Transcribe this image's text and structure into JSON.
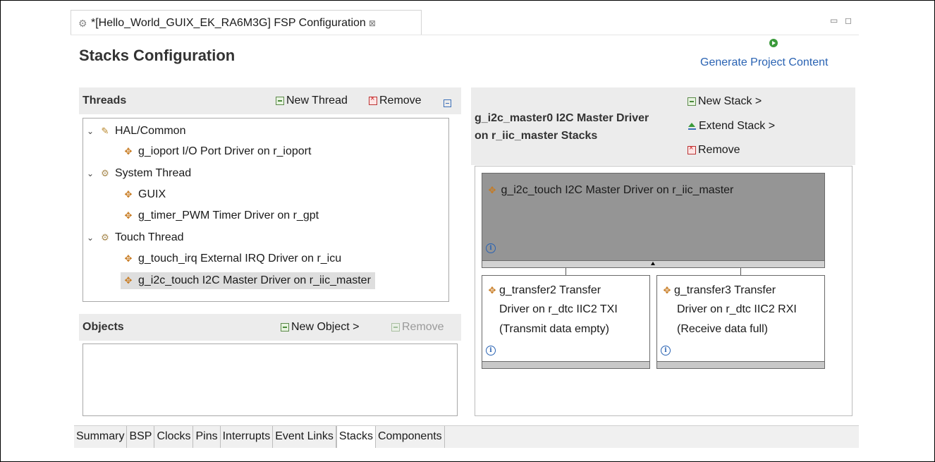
{
  "editor": {
    "tab_title": "*[Hello_World_GUIX_EK_RA6M3G] FSP Configuration",
    "close_glyph": "⊠",
    "minimize_glyph": "▭",
    "maximize_glyph": "◻"
  },
  "page": {
    "title": "Stacks Configuration",
    "generate_label": "Generate Project Content"
  },
  "threads": {
    "title": "Threads",
    "new_thread": "New Thread",
    "remove": "Remove",
    "tree": [
      {
        "label": "HAL/Common",
        "level": 0,
        "icon": "hal-icon",
        "expanded": true
      },
      {
        "label": "g_ioport I/O Port Driver on r_ioport",
        "level": 1,
        "icon": "module-icon"
      },
      {
        "label": "System Thread",
        "level": 0,
        "icon": "thread-gear-icon",
        "expanded": true
      },
      {
        "label": "GUIX",
        "level": 1,
        "icon": "module-icon"
      },
      {
        "label": "g_timer_PWM Timer Driver on r_gpt",
        "level": 1,
        "icon": "module-icon"
      },
      {
        "label": "Touch Thread",
        "level": 0,
        "icon": "thread-gear-icon",
        "expanded": true
      },
      {
        "label": "g_touch_irq External IRQ Driver on r_icu",
        "level": 1,
        "icon": "module-icon"
      },
      {
        "label": "g_i2c_touch I2C Master Driver on r_iic_master",
        "level": 1,
        "icon": "module-icon",
        "selected": true
      }
    ]
  },
  "objects": {
    "title": "Objects",
    "new_object": "New Object >",
    "remove": "Remove"
  },
  "stacks": {
    "title_line1": "g_i2c_master0 I2C Master Driver",
    "title_line2": "on r_iic_master Stacks",
    "new_stack": "New Stack >",
    "extend_stack": "Extend Stack >",
    "remove": "Remove",
    "main_block": "g_i2c_touch I2C Master Driver on r_iic_master",
    "sub_blocks": [
      {
        "line1": "g_transfer2 Transfer",
        "line2": "Driver on r_dtc IIC2 TXI",
        "line3": "(Transmit data empty)"
      },
      {
        "line1": "g_transfer3 Transfer",
        "line2": "Driver on r_dtc IIC2 RXI",
        "line3": "(Receive data full)"
      }
    ],
    "info_glyph": "i"
  },
  "bottom_tabs": [
    "Summary",
    "BSP",
    "Clocks",
    "Pins",
    "Interrupts",
    "Event Links",
    "Stacks",
    "Components"
  ],
  "active_tab": "Stacks",
  "colors": {
    "link": "#2a63b3",
    "block_main": "#959595",
    "header_bg": "#ececec"
  }
}
